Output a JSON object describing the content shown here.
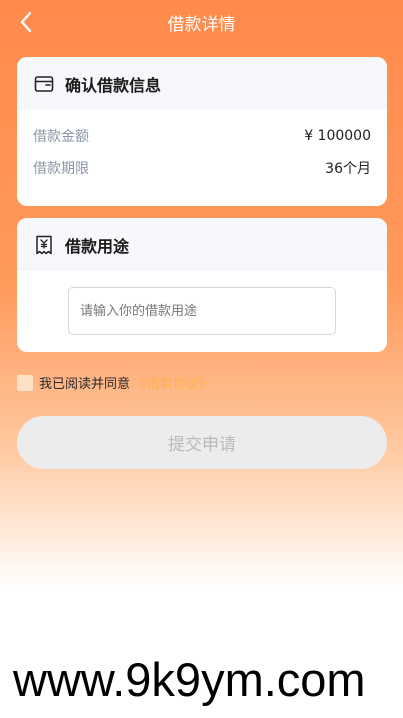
{
  "nav": {
    "title": "借款详情",
    "back_icon": "chevron-left-icon"
  },
  "confirm_card": {
    "icon": "wallet-icon",
    "title": "确认借款信息",
    "rows": [
      {
        "label": "借款金额",
        "value": "¥ 100000"
      },
      {
        "label": "借款期限",
        "value": "36个月"
      }
    ]
  },
  "purpose_card": {
    "icon": "receipt-icon",
    "title": "借款用途",
    "input": {
      "value": "",
      "placeholder": "请输入你的借款用途"
    }
  },
  "agreement": {
    "text": "我已阅读并同意",
    "link": "《借款协议》",
    "checked": false
  },
  "submit": {
    "label": "提交申请"
  },
  "watermark": {
    "text": "www.9k9ym.com"
  },
  "colors": {
    "accent": "#ff8a4c",
    "link": "#ffb24a",
    "button_bg": "#ececec",
    "button_text": "#b9b9b9"
  }
}
